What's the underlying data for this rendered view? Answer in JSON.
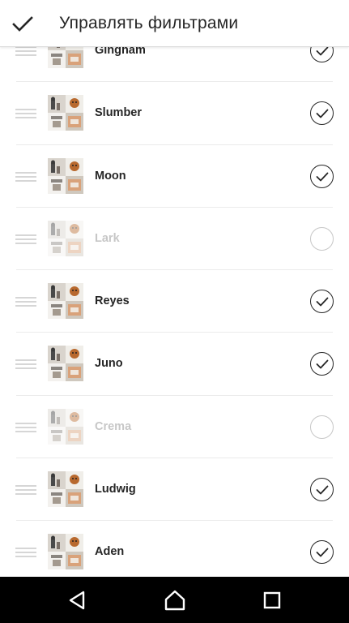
{
  "header": {
    "title": "Управлять фильтрами",
    "done_icon": "check-icon"
  },
  "filters": [
    {
      "name": "Gingham",
      "enabled": true
    },
    {
      "name": "Slumber",
      "enabled": true
    },
    {
      "name": "Moon",
      "enabled": true
    },
    {
      "name": "Lark",
      "enabled": false
    },
    {
      "name": "Reyes",
      "enabled": true
    },
    {
      "name": "Juno",
      "enabled": true
    },
    {
      "name": "Crema",
      "enabled": false
    },
    {
      "name": "Ludwig",
      "enabled": true
    },
    {
      "name": "Aden",
      "enabled": true
    }
  ],
  "nav": {
    "back_icon": "back-triangle-icon",
    "home_icon": "home-icon",
    "recents_icon": "recents-square-icon"
  },
  "colors": {
    "text": "#262626",
    "disabled": "#c7c7c7",
    "divider": "#ebebeb",
    "nav_background": "#000000"
  }
}
